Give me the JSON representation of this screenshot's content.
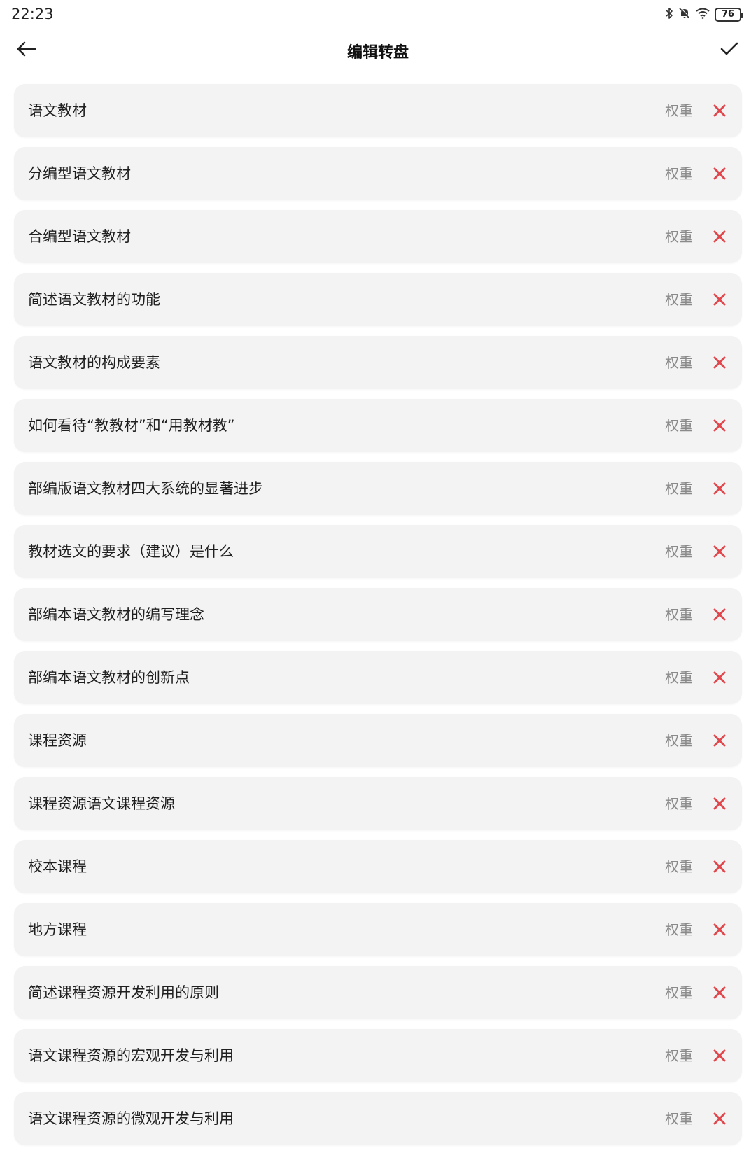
{
  "status_bar": {
    "time": "22:23",
    "battery": "76",
    "icons": [
      "bluetooth-icon",
      "mute-bell-icon",
      "wifi-icon",
      "battery-icon"
    ]
  },
  "header": {
    "title": "编辑转盘",
    "back_icon": "arrow-left-icon",
    "confirm_icon": "checkmark-icon"
  },
  "colors": {
    "delete": "#e0474c",
    "item_background": "#f3f3f3",
    "weight_text": "#8a8a8a"
  },
  "items": [
    {
      "label": "语文教材",
      "weight_label": "权重"
    },
    {
      "label": "分编型语文教材",
      "weight_label": "权重"
    },
    {
      "label": "合编型语文教材",
      "weight_label": "权重"
    },
    {
      "label": "简述语文教材的功能",
      "weight_label": "权重"
    },
    {
      "label": "语文教材的构成要素",
      "weight_label": "权重"
    },
    {
      "label": "如何看待“教教材”和“用教材教”",
      "weight_label": "权重"
    },
    {
      "label": "部编版语文教材四大系统的显著进步",
      "weight_label": "权重"
    },
    {
      "label": "教材选文的要求（建议）是什么",
      "weight_label": "权重"
    },
    {
      "label": "部编本语文教材的编写理念",
      "weight_label": "权重"
    },
    {
      "label": "部编本语文教材的创新点",
      "weight_label": "权重"
    },
    {
      "label": "课程资源",
      "weight_label": "权重"
    },
    {
      "label": "课程资源语文课程资源",
      "weight_label": "权重"
    },
    {
      "label": "校本课程",
      "weight_label": "权重"
    },
    {
      "label": "地方课程",
      "weight_label": "权重"
    },
    {
      "label": "简述课程资源开发利用的原则",
      "weight_label": "权重"
    },
    {
      "label": "语文课程资源的宏观开发与利用",
      "weight_label": "权重"
    },
    {
      "label": "语文课程资源的微观开发与利用",
      "weight_label": "权重"
    }
  ]
}
